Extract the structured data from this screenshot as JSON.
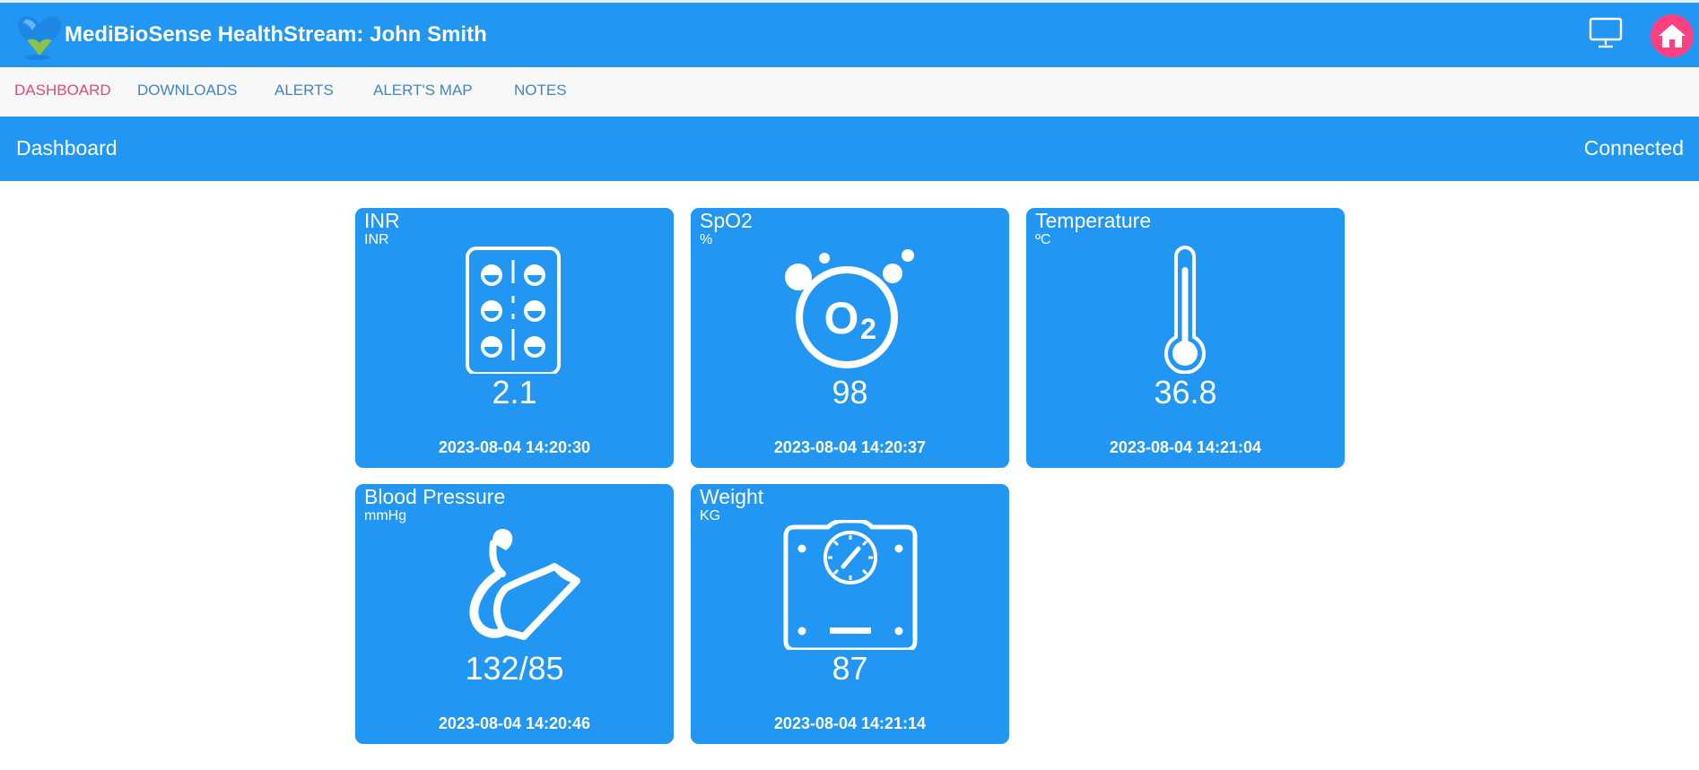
{
  "header": {
    "title": "MediBioSense HealthStream: John Smith",
    "logo_icon": "heart-logo-icon",
    "monitor_icon": "monitor-icon",
    "home_icon": "home-icon"
  },
  "nav": {
    "items": [
      {
        "label": "DASHBOARD",
        "active": true
      },
      {
        "label": "DOWNLOADS",
        "active": false
      },
      {
        "label": "ALERTS",
        "active": false
      },
      {
        "label": "ALERT'S MAP",
        "active": false
      },
      {
        "label": "NOTES",
        "active": false
      }
    ]
  },
  "subheader": {
    "title": "Dashboard",
    "status": "Connected"
  },
  "cards": [
    {
      "title": "INR",
      "unit": "INR",
      "icon": "pill-pack-icon",
      "value": "2.1",
      "timestamp": "2023-08-04 14:20:30"
    },
    {
      "title": "SpO2",
      "unit": "%",
      "icon": "oxygen-icon",
      "value": "98",
      "timestamp": "2023-08-04 14:20:37"
    },
    {
      "title": "Temperature",
      "unit": "ºC",
      "icon": "thermometer-icon",
      "value": "36.8",
      "timestamp": "2023-08-04 14:21:04"
    },
    {
      "title": "Blood Pressure",
      "unit": "mmHg",
      "icon": "blood-pressure-cuff-icon",
      "value": "132/85",
      "timestamp": "2023-08-04 14:20:46"
    },
    {
      "title": "Weight",
      "unit": "KG",
      "icon": "weighing-scale-icon",
      "value": "87",
      "timestamp": "2023-08-04 14:21:14"
    }
  ],
  "colors": {
    "primary": "#2196f3",
    "accent": "#ff4081",
    "nav_active": "#e0487a",
    "nav_link": "#3f86c4"
  }
}
